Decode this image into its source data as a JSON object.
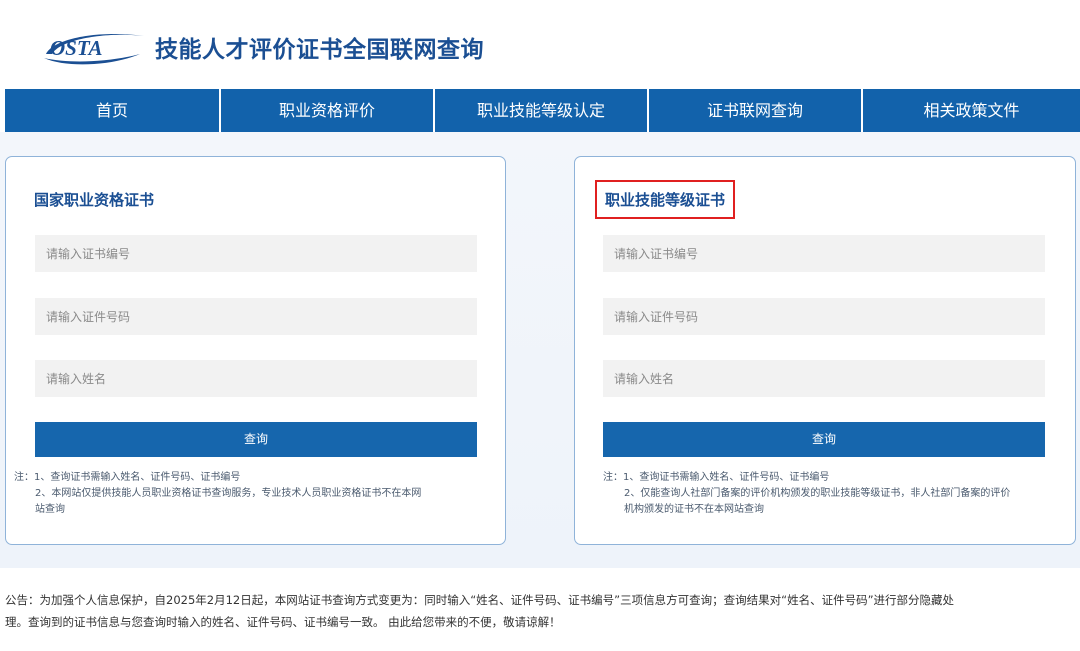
{
  "header": {
    "logo_text": "OSTA",
    "title": "技能人才评价证书全国联网查询"
  },
  "nav": {
    "items": [
      {
        "label": "首页"
      },
      {
        "label": "职业资格评价"
      },
      {
        "label": "职业技能等级认定"
      },
      {
        "label": "证书联网查询"
      },
      {
        "label": "相关政策文件"
      }
    ]
  },
  "left_card": {
    "title": "国家职业资格证书",
    "cert_no_placeholder": "请输入证书编号",
    "id_no_placeholder": "请输入证件号码",
    "name_placeholder": "请输入姓名",
    "query_label": "查询",
    "note_1": "注：1、查询证书需输入姓名、证件号码、证书编号",
    "note_2a": "2、本网站仅提供技能人员职业资格证书查询服务，专业技术人员职业资格证书不在本网",
    "note_2b": "站查询"
  },
  "right_card": {
    "title": "职业技能等级证书",
    "cert_no_placeholder": "请输入证书编号",
    "id_no_placeholder": "请输入证件号码",
    "name_placeholder": "请输入姓名",
    "query_label": "查询",
    "note_1": "注：1、查询证书需输入姓名、证件号码、证书编号",
    "note_2a": "2、仅能查询人社部门备案的评价机构颁发的职业技能等级证书，非人社部门备案的评价",
    "note_2b": "机构颁发的证书不在本网站查询"
  },
  "notice": {
    "line_1": "公告：为加强个人信息保护，自2025年2月12日起，本网站证书查询方式变更为：同时输入“姓名、证件号码、证书编号”三项信息方可查询；查询结果对“姓名、证件号码”进行部分隐藏处",
    "line_2": "理。查询到的证书信息与您查询时输入的姓名、证件号码、证书编号一致。 由此给您带来的不便，敬请谅解！"
  },
  "colors": {
    "brand_blue": "#1b4f93",
    "nav_blue": "#1262ab",
    "button_blue": "#1666ad",
    "highlight_red": "#e02020"
  }
}
